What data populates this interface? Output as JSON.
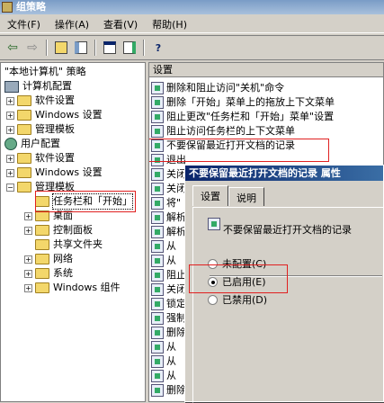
{
  "window": {
    "title": "组策略"
  },
  "menu": [
    "文件(F)",
    "操作(A)",
    "查看(V)",
    "帮助(H)"
  ],
  "tree": {
    "root": "\"本地计算机\" 策略",
    "computer": {
      "label": "计算机配置",
      "children": [
        "软件设置",
        "Windows 设置",
        "管理模板"
      ]
    },
    "user": {
      "label": "用户配置",
      "children": [
        "软件设置",
        "Windows 设置",
        "管理模板"
      ]
    },
    "admin_children": [
      "任务栏和「开始」",
      "桌面",
      "控制面板",
      "共享文件夹",
      "网络",
      "系统",
      "Windows 组件"
    ]
  },
  "list": {
    "header": "设置",
    "items": [
      "删除和阻止访问\"关机\"命令",
      "删除「开始」菜单上的拖放上下文菜单",
      "阻止更改\"任务栏和「开始」菜单\"设置",
      "阻止访问任务栏的上下文菜单",
      "不要保留最近打开文档的记录",
      "退出",
      "关闭",
      "关闭",
      "将\"",
      "解析",
      "解析",
      "从",
      "从",
      "阻止",
      "关闭",
      "锁定",
      "强制",
      "删除",
      "从",
      "从",
      "从",
      "删除"
    ]
  },
  "dialog": {
    "title": "不要保留最近打开文档的记录 属性",
    "tabs": [
      "设置",
      "说明"
    ],
    "policy_name": "不要保留最近打开文档的记录",
    "options": [
      {
        "label": "未配置",
        "key": "(C)",
        "selected": false
      },
      {
        "label": "已启用",
        "key": "(E)",
        "selected": true
      },
      {
        "label": "已禁用",
        "key": "(D)",
        "selected": false
      }
    ]
  }
}
